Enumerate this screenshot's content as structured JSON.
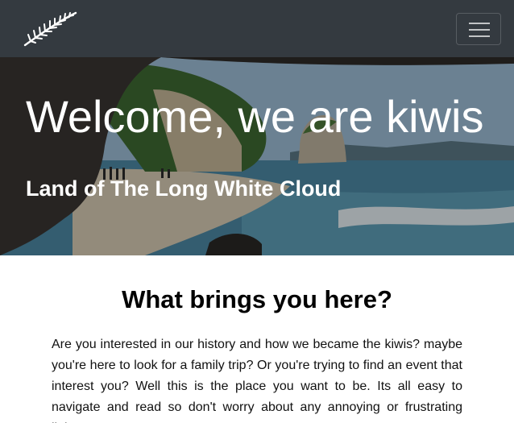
{
  "navbar": {
    "brand_icon": "silver-fern-icon",
    "toggler_icon": "hamburger-menu-icon",
    "background": "#343a40"
  },
  "hero": {
    "title": "Welcome, we are kiwis",
    "subtitle": "Land of The Long White Cloud"
  },
  "main": {
    "heading": "What brings you here?",
    "paragraph": "Are you interested in our history and how we became the kiwis? maybe you're here to look for a family trip? Or you're trying to find an event that interest you? Well this is the place you want to be. Its all easy to navigate and read so don't worry about any annoying or frustrating links."
  }
}
